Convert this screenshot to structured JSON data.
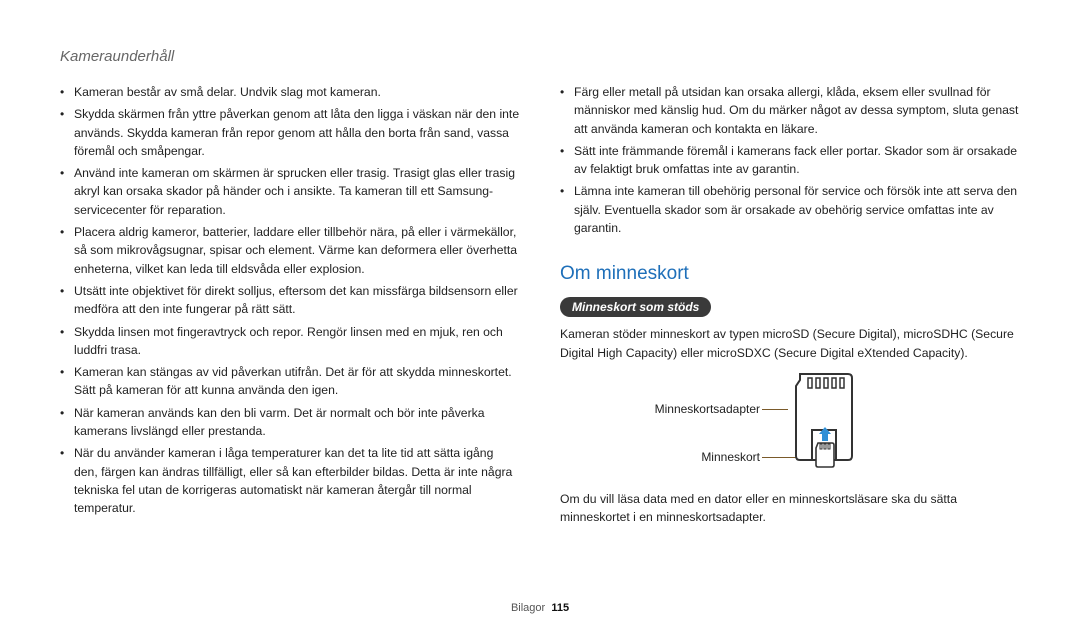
{
  "header": {
    "section": "Kameraunderhåll"
  },
  "left": {
    "bullets": [
      "Kameran består av små delar. Undvik slag mot kameran.",
      "Skydda skärmen från yttre påverkan genom att låta den ligga i väskan när den inte används. Skydda kameran från repor genom att hålla den borta från sand, vassa föremål och småpengar.",
      "Använd inte kameran om skärmen är sprucken eller trasig. Trasigt glas eller trasig akryl kan orsaka skador på händer och i ansikte. Ta kameran till ett Samsung-servicecenter för reparation.",
      "Placera aldrig kameror, batterier, laddare eller tillbehör nära, på eller i värmekällor, så som mikrovågsugnar, spisar och element. Värme kan deformera eller överhetta enheterna, vilket kan leda till eldsvåda eller explosion.",
      "Utsätt inte objektivet för direkt solljus, eftersom det kan missfärga bildsensorn eller medföra att den inte fungerar på rätt sätt.",
      "Skydda linsen mot fingeravtryck och repor. Rengör linsen med en mjuk, ren och luddfri trasa.",
      "Kameran kan stängas av vid påverkan utifrån. Det är för att skydda minneskortet. Sätt på kameran för att kunna använda den igen.",
      "När kameran används kan den bli varm. Det är normalt och bör inte påverka kamerans livslängd eller prestanda.",
      "När du använder kameran i låga temperaturer kan det ta lite tid att sätta igång den, färgen kan ändras tillfälligt, eller så kan efterbilder bildas. Detta är inte några tekniska fel utan de korrigeras automatiskt när kameran återgår till normal temperatur."
    ]
  },
  "right": {
    "bullets_top": [
      "Färg eller metall på utsidan kan orsaka allergi, klåda, eksem eller svullnad för människor med känslig hud. Om du märker något av dessa symptom, sluta genast att använda kameran och kontakta en läkare.",
      "Sätt inte främmande föremål i kamerans fack eller portar. Skador som är orsakade av felaktigt bruk omfattas inte av garantin.",
      "Lämna inte kameran till obehörig personal för service och försök inte att serva den själv. Eventuella skador som är orsakade av obehörig service omfattas inte av garantin."
    ],
    "heading": "Om minneskort",
    "pill": "Minneskort som stöds",
    "intro": "Kameran stöder minneskort av typen microSD (Secure Digital), microSDHC (Secure Digital High Capacity) eller microSDXC (Secure Digital eXtended Capacity).",
    "labels": {
      "adapter": "Minneskortsadapter",
      "card": "Minneskort"
    },
    "outro": "Om du vill läsa data med en dator eller en minneskortsläsare ska du sätta minneskortet i en minneskortsadapter."
  },
  "footer": {
    "section": "Bilagor",
    "page": "115"
  },
  "icons": {
    "sd_adapter": "sd-adapter-icon",
    "micro_sd": "micro-sd-icon",
    "arrow_up": "arrow-up-icon"
  }
}
